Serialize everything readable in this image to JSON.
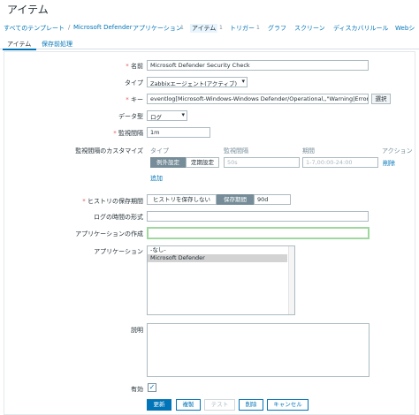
{
  "page_title": "アイテム",
  "breadcrumb": [
    {
      "label": "すべてのテンプレート"
    },
    {
      "label": "/"
    },
    {
      "label": "Microsoft Defender"
    },
    {
      "label": "アプリケーション"
    },
    {
      "label": "1"
    },
    {
      "label": "アイテム"
    },
    {
      "label": "1"
    },
    {
      "label": "トリガー"
    },
    {
      "label": "1"
    },
    {
      "label": "グラフ"
    },
    {
      "label": "スクリーン"
    },
    {
      "label": "ディスカバリルール"
    },
    {
      "label": "Webシ"
    }
  ],
  "tabs": [
    {
      "label": "アイテム"
    },
    {
      "label": "保存前処理"
    }
  ],
  "form": {
    "name_label": "名前",
    "name_value": "Microsoft Defender Security Check",
    "type_label": "タイプ",
    "type_value": "Zabbixエージェント(アクティブ)",
    "key_label": "キー",
    "key_value": "eventlog[Microsoft-Windows-Windows Defender/Operational,,\"Warning|Error|Critica",
    "select_button": "選択",
    "datatype_label": "データ型",
    "datatype_value": "ログ",
    "interval_label": "監視間隔",
    "interval_value": "1m",
    "custom_interval_label": "監視間隔のカスタマイズ",
    "custom_cols": {
      "type": "タイプ",
      "interval": "監視間隔",
      "period": "期間",
      "action": "アクション"
    },
    "custom_row": {
      "type_on": "例外設定",
      "type_off": "定期設定",
      "interval_placeholder": "50s",
      "period_placeholder": "1-7,00:00-24:00",
      "delete": "削除"
    },
    "add_link": "追加",
    "history_label": "ヒストリの保存期間",
    "history_off": "ヒストリを保存しない",
    "history_on": "保存期間",
    "history_value": "90d",
    "log_time_label": "ログの時間の形式",
    "log_time_value": "",
    "new_app_label": "アプリケーションの作成",
    "new_app_value": "",
    "apps_label": "アプリケーション",
    "apps_options": [
      "-なし-",
      "Microsoft Defender"
    ],
    "description_label": "説明",
    "description_value": "",
    "enabled_label": "有効",
    "enabled_mark": "✓"
  },
  "buttons": {
    "update": "更新",
    "clone": "複製",
    "test": "テスト",
    "delete": "削除",
    "cancel": "キャンセル"
  },
  "colors": {
    "accent": "#0275b8",
    "required": "#e45959",
    "active_segment": "#768d99",
    "focus_border": "#9fd89f"
  }
}
